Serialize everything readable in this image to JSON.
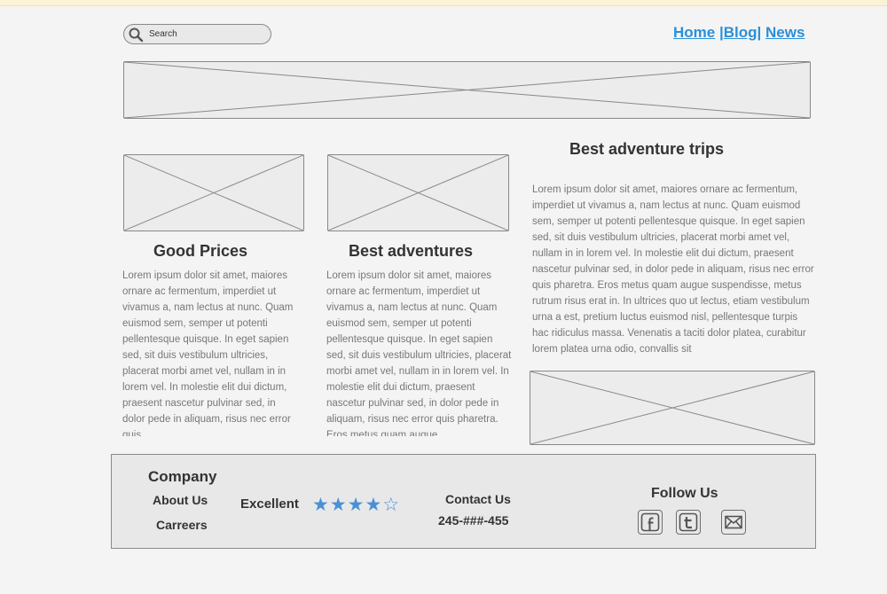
{
  "header": {
    "search": {
      "placeholder": "Search"
    },
    "nav": {
      "home": "Home",
      "sep1": " |",
      "blog": "Blog",
      "sep2": "| ",
      "news": "News"
    }
  },
  "columns": [
    {
      "title": "Good Prices",
      "text": "Lorem ipsum dolor sit amet, maiores ornare ac fermentum, imperdiet ut vivamus a, nam lectus at nunc. Quam euismod sem, semper ut potenti pellentesque quisque. In eget sapien sed, sit duis vestibulum ultricies, placerat morbi amet vel, nullam in in lorem vel. In molestie elit dui dictum, praesent nascetur pulvinar sed, in dolor pede in aliquam, risus nec error quis"
    },
    {
      "title": "Best adventures",
      "text": "Lorem ipsum dolor sit amet, maiores ornare ac fermentum, imperdiet ut vivamus a, nam lectus at nunc. Quam euismod sem, semper ut potenti pellentesque quisque. In eget sapien sed, sit duis vestibulum ultricies, placerat morbi amet vel, nullam in in lorem vel. In molestie elit dui dictum, praesent nascetur pulvinar sed, in dolor pede in aliquam, risus nec error quis pharetra. Eros metus quam augue"
    },
    {
      "title": "Best adventure trips",
      "text": "Lorem ipsum dolor sit amet, maiores ornare ac fermentum, imperdiet ut vivamus a, nam lectus at nunc. Quam euismod sem, semper ut potenti pellentesque quisque. In eget sapien sed, sit duis vestibulum ultricies, placerat morbi amet vel, nullam in in lorem vel. In molestie elit dui dictum, praesent nascetur pulvinar sed, in dolor pede in aliquam, risus nec error quis pharetra. Eros metus quam augue suspendisse, metus rutrum risus erat in.  In ultrices quo ut lectus, etiam vestibulum urna a est, pretium luctus euismod nisl, pellentesque turpis hac ridiculus massa. Venenatis a taciti dolor platea, curabitur lorem platea urna odio, convallis sit"
    }
  ],
  "footer": {
    "company": "Company",
    "about": "About Us",
    "careers": "Carreers",
    "rating_label": "Excellent",
    "rating": {
      "value": 4,
      "max": 5,
      "filled": "★★★★",
      "empty": "☆"
    },
    "contact_title": "Contact Us",
    "phone": "245-###-455",
    "follow": "Follow Us",
    "social": [
      "facebook-icon",
      "twitter-icon",
      "mail-icon"
    ]
  },
  "colors": {
    "link": "#2b8fd8",
    "star": "#4a90d6",
    "placeholder_fill": "#ececec",
    "border": "#888888"
  }
}
